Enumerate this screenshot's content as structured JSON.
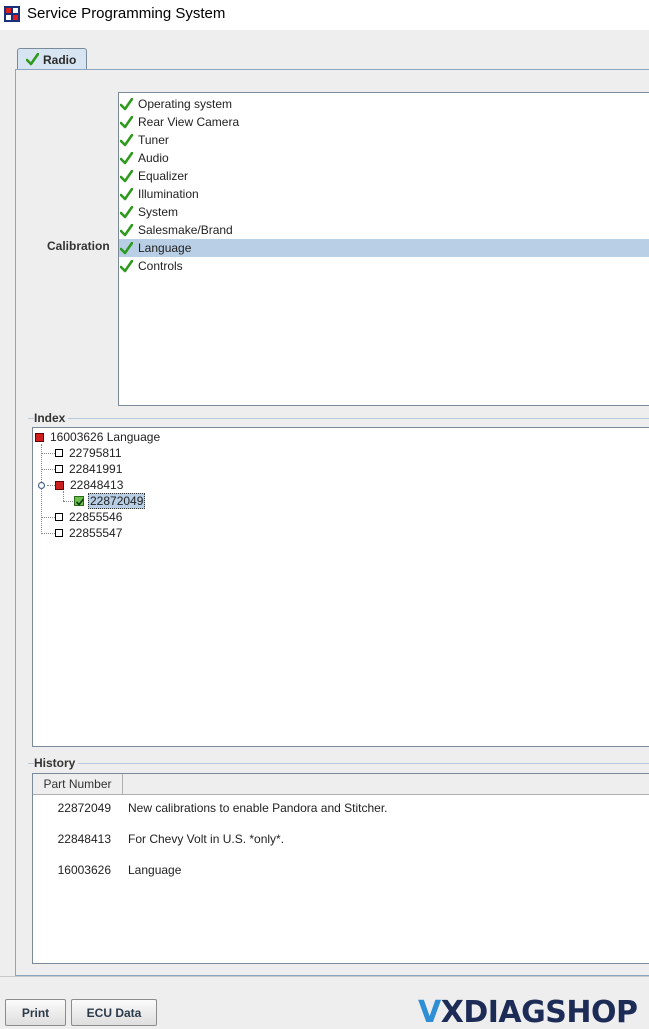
{
  "window": {
    "title": "Service Programming System",
    "icon": "app-logo-icon"
  },
  "tabs": [
    {
      "label": "Radio",
      "icon": "check-icon",
      "active": true
    }
  ],
  "calibration": {
    "label": "Calibration",
    "items": [
      {
        "label": "Operating system",
        "checked": true,
        "selected": false
      },
      {
        "label": "Rear View Camera",
        "checked": true,
        "selected": false
      },
      {
        "label": "Tuner",
        "checked": true,
        "selected": false
      },
      {
        "label": "Audio",
        "checked": true,
        "selected": false
      },
      {
        "label": "Equalizer",
        "checked": true,
        "selected": false
      },
      {
        "label": "Illumination",
        "checked": true,
        "selected": false
      },
      {
        "label": "System",
        "checked": true,
        "selected": false
      },
      {
        "label": "Salesmake/Brand",
        "checked": true,
        "selected": false
      },
      {
        "label": "Language",
        "checked": true,
        "selected": true
      },
      {
        "label": "Controls",
        "checked": true,
        "selected": false
      }
    ]
  },
  "index": {
    "label": "Index",
    "root": {
      "label": "16003626 Language",
      "icon": "red-node-icon"
    },
    "children": [
      {
        "label": "22795811",
        "icon": "empty-node-icon"
      },
      {
        "label": "22841991",
        "icon": "empty-node-icon"
      },
      {
        "label": "22848413",
        "icon": "red-node-icon",
        "expanded": true,
        "children": [
          {
            "label": "22872049",
            "icon": "green-check-node-icon",
            "selected": true
          }
        ]
      },
      {
        "label": "22855546",
        "icon": "empty-node-icon"
      },
      {
        "label": "22855547",
        "icon": "empty-node-icon"
      }
    ]
  },
  "history": {
    "label": "History",
    "column_header": "Part Number",
    "rows": [
      {
        "part": "22872049",
        "description": "New calibrations to enable Pandora and Stitcher."
      },
      {
        "part": "22848413",
        "description": "For Chevy Volt in U.S. *only*."
      },
      {
        "part": "16003626",
        "description": "Language"
      }
    ]
  },
  "buttons": {
    "print": "Print",
    "ecu_data": "ECU Data"
  },
  "watermark": {
    "v": "V",
    "rest": "XDIAGSHOP"
  },
  "colors": {
    "check_green": "#2e9a1e",
    "selection": "#b8cfe5",
    "tab_bg": "#d7e4f2"
  }
}
